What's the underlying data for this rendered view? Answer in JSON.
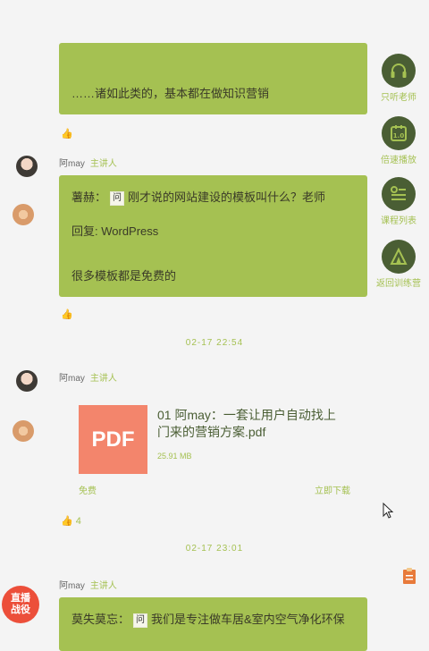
{
  "messages": {
    "m1": {
      "text": "……诸如此类的，基本都在做知识营销"
    },
    "m2": {
      "name": "阿may",
      "role": "主讲人",
      "line1_user": "薯赫：",
      "line1_icon": "问",
      "line1_text": "刚才说的网站建设的模板叫什么？老师",
      "line2": "回复: WordPress",
      "line3": "很多模板都是免费的"
    },
    "time1": "02-17 22:54",
    "m3": {
      "name": "阿may",
      "role": "主讲人",
      "file_icon": "PDF",
      "file_name": "01 阿may：一套让用户自动找上门来的营销方案.pdf",
      "file_size": "25.91 MB",
      "free_label": "免费",
      "download_label": "立即下载",
      "like_count": "4"
    },
    "time2": "02-17 23:01",
    "m4": {
      "name": "阿may",
      "role": "主讲人",
      "user": "莫失莫忘：",
      "icon": "问",
      "text": "我们是专注做车居&室内空气净化环保"
    }
  },
  "sidebar": {
    "items": [
      {
        "label": "只听老师",
        "icon": "headphones-icon"
      },
      {
        "label": "倍速播放",
        "icon": "speed-icon"
      },
      {
        "label": "课程列表",
        "icon": "list-icon"
      },
      {
        "label": "返回训练营",
        "icon": "camp-icon"
      }
    ]
  },
  "live_badge": "直播\n战役",
  "colors": {
    "bubble": "#a5c152",
    "sidebar": "#4a5e34",
    "pdf": "#f3856c"
  }
}
